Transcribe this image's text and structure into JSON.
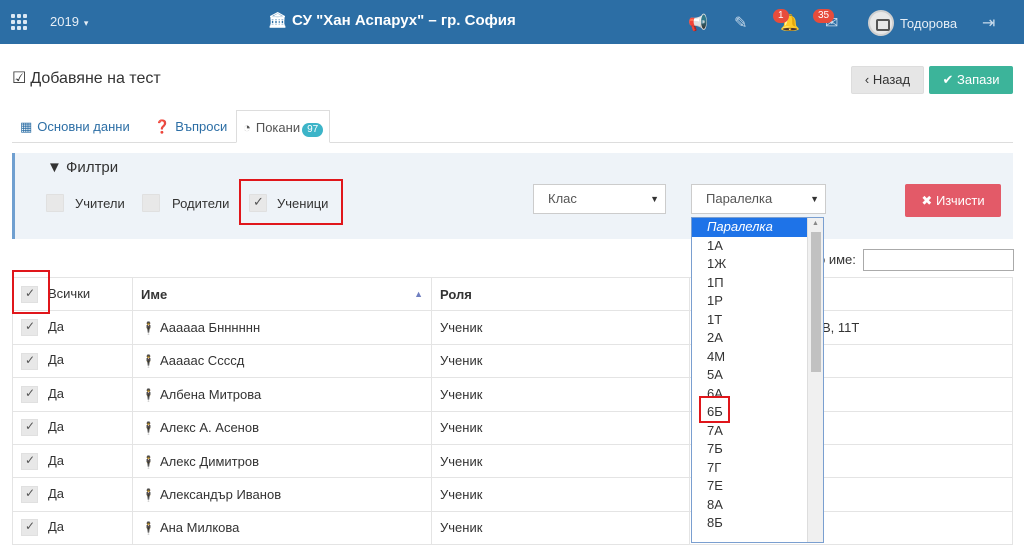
{
  "topbar": {
    "year": "2019",
    "school": "СУ \"Хан Аспарух\" – гр. София",
    "notif_count": "1",
    "msg_count": "35",
    "username": "Тодорова"
  },
  "page": {
    "title": "Добавяне на тест",
    "back_label": "Назад",
    "save_label": "Запази"
  },
  "tabs": [
    {
      "label": "Основни данни"
    },
    {
      "label": "Въпроси"
    },
    {
      "label": "Покани",
      "count": "97"
    }
  ],
  "filters": {
    "title": "Филтри",
    "teachers": "Учители",
    "parents": "Родители",
    "students": "Ученици",
    "class_select": "Клас",
    "section_select": "Паралелка",
    "clear_label": "Изчисти"
  },
  "search": {
    "label": "о име:"
  },
  "table": {
    "headers": [
      "Всички",
      "Име",
      "Роля",
      ""
    ],
    "rows": [
      {
        "selected": "Да",
        "name": "Аааааа Бнннннн",
        "role": "Ученик",
        "extra": "В, 11Т"
      },
      {
        "selected": "Да",
        "name": "Ааааас Ссссд",
        "role": "Ученик",
        "extra": ""
      },
      {
        "selected": "Да",
        "name": "Албена Митрова",
        "role": "Ученик",
        "extra": ""
      },
      {
        "selected": "Да",
        "name": "Алекс А. Асенов",
        "role": "Ученик",
        "extra": ""
      },
      {
        "selected": "Да",
        "name": "Алекс Димитров",
        "role": "Ученик",
        "extra": ""
      },
      {
        "selected": "Да",
        "name": "Александър Иванов",
        "role": "Ученик",
        "extra": ""
      },
      {
        "selected": "Да",
        "name": "Ана Милкова",
        "role": "Ученик",
        "extra": ""
      }
    ]
  },
  "dropdown": {
    "options": [
      "Паралелка",
      "1А",
      "1Ж",
      "1П",
      "1Р",
      "1Т",
      "2А",
      "4М",
      "5А",
      "6А",
      "6Б",
      "7А",
      "7Б",
      "7Г",
      "7Е",
      "8А",
      "8Б"
    ]
  }
}
